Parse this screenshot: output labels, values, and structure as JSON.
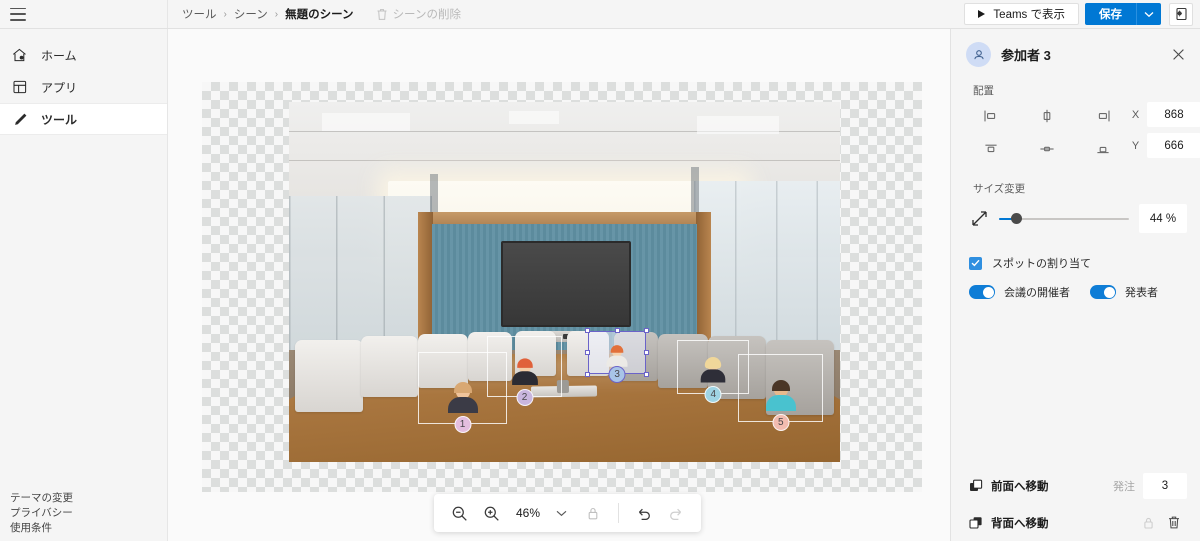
{
  "topbar": {
    "menu_icon": "hamburger-icon",
    "breadcrumb": [
      {
        "label": "ツール",
        "current": false
      },
      {
        "label": "シーン",
        "current": false
      },
      {
        "label": "無題のシーン",
        "current": true
      }
    ],
    "separator": "›",
    "delete_scene": {
      "label": "シーンの削除",
      "icon": "trash-icon"
    },
    "teams_button": {
      "label": "Teams で表示",
      "icon": "play-icon"
    },
    "save_button": {
      "label": "保存",
      "caret_icon": "chevron-down-icon",
      "color": "#0078d4"
    },
    "share_button": {
      "icon": "share-screen-icon"
    }
  },
  "sidebar": {
    "items": [
      {
        "label": "ホーム",
        "icon": "home-icon",
        "active": false
      },
      {
        "label": "アプリ",
        "icon": "apps-grid-icon",
        "active": false
      },
      {
        "label": "ツール",
        "icon": "pencil-icon",
        "active": true
      }
    ],
    "footer_links": [
      {
        "label": "テーマの変更"
      },
      {
        "label": "プライバシー"
      },
      {
        "label": "使用条件"
      }
    ]
  },
  "canvas": {
    "participants": [
      {
        "number": "1",
        "badge_color": "#e4bede",
        "hair_color": "#d9a873",
        "body_color": "#3b3b46",
        "skin": "#f0c49b"
      },
      {
        "number": "2",
        "badge_color": "#c9b6de",
        "hair_color": "#e0613a",
        "body_color": "#2b2b33",
        "skin": "#f4cda6"
      },
      {
        "number": "3",
        "badge_color": "#a8c4e8",
        "hair_color": "#e2703a",
        "body_color": "#eceae6",
        "skin": "#f5d2ae",
        "selected": true
      },
      {
        "number": "4",
        "badge_color": "#9fd4e4",
        "hair_color": "#f0d79a",
        "body_color": "#2e2e38",
        "skin": "#f3cfa8"
      },
      {
        "number": "5",
        "badge_color": "#f2bcb0",
        "hair_color": "#4a3626",
        "body_color": "#49c2cf",
        "skin": "#e8b98d"
      }
    ]
  },
  "zoom_toolbar": {
    "zoom_out_icon": "zoom-out-icon",
    "zoom_in_icon": "zoom-in-icon",
    "zoom_level": "46%",
    "caret_icon": "chevron-down-icon",
    "lock_icon": "lock-icon",
    "undo_icon": "undo-icon",
    "redo_icon": "redo-icon"
  },
  "properties": {
    "avatar_icon": "person-icon",
    "title": "参加者 3",
    "close_icon": "close-icon",
    "alignment": {
      "label": "配置",
      "buttons": [
        {
          "icon": "align-left-icon"
        },
        {
          "icon": "align-center-horizontal-icon"
        },
        {
          "icon": "align-right-icon"
        },
        {
          "icon": "align-top-icon"
        },
        {
          "icon": "align-middle-vertical-icon"
        },
        {
          "icon": "align-bottom-icon"
        }
      ],
      "x_label": "X",
      "x_value": "868",
      "y_label": "Y",
      "y_value": "666"
    },
    "resize": {
      "label": "サイズ変更",
      "icon": "resize-diagonal-icon",
      "value": "44 %",
      "slider_percent": 13
    },
    "spot_assign": {
      "label": "スポットの割り当て",
      "checked": true
    },
    "toggles": [
      {
        "label": "会議の開催者",
        "on": true
      },
      {
        "label": "発表者",
        "on": true
      }
    ],
    "bring_forward": {
      "label": "前面へ移動",
      "icon": "bring-forward-icon"
    },
    "send_backward": {
      "label": "背面へ移動",
      "icon": "send-backward-icon"
    },
    "order": {
      "label": "発注",
      "value": "3"
    },
    "lock_icon": "lock-icon",
    "delete_icon": "trash-icon"
  }
}
